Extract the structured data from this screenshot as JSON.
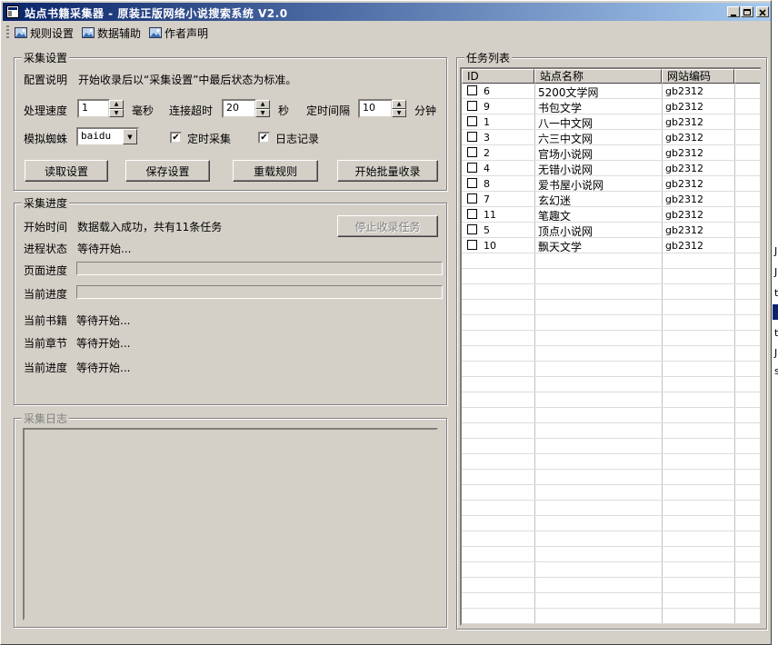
{
  "window": {
    "title": "站点书籍采集器 - 原装正版网络小说搜索系统 V2.0",
    "title_icon": "app-window-icon",
    "controls": [
      "minimize-icon",
      "maximize-icon",
      "close-icon"
    ]
  },
  "menu": [
    {
      "label": "规则设置",
      "icon": "image-icon"
    },
    {
      "label": "数据辅助",
      "icon": "image-icon"
    },
    {
      "label": "作者声明",
      "icon": "image-icon"
    }
  ],
  "settings": {
    "legend": "采集设置",
    "config_label": "配置说明",
    "config_desc": "开始收录后以“采集设置”中最后状态为标准。",
    "speed_label": "处理速度",
    "speed_value": "1",
    "speed_unit": "毫秒",
    "timeout_label": "连接超时",
    "timeout_value": "20",
    "timeout_unit": "秒",
    "interval_label": "定时间隔",
    "interval_value": "10",
    "interval_unit": "分钟",
    "spider_label": "模拟蜘蛛",
    "spider_value": "baidu",
    "timed_label": "定时采集",
    "timed_checked": true,
    "log_label": "日志记录",
    "log_checked": true,
    "btn_read": "读取设置",
    "btn_save": "保存设置",
    "btn_reload": "重载规则",
    "btn_start": "开始批量收录"
  },
  "progress": {
    "legend": "采集进度",
    "start_time_label": "开始时间",
    "start_time_value": "数据载入成功，共有11条任务",
    "stop_button": "停止收录任务",
    "status_label": "进程状态",
    "status_value": "等待开始...",
    "page_progress_label": "页面进度",
    "page_progress_value": 0,
    "current_progress_label": "当前进度",
    "current_progress_value": 0,
    "book_label": "当前书籍",
    "book_value": "等待开始...",
    "chapter_label": "当前章节",
    "chapter_value": "等待开始...",
    "current2_label": "当前进度",
    "current2_value": "等待开始..."
  },
  "log": {
    "legend": "采集日志"
  },
  "tasks": {
    "legend": "任务列表",
    "columns": [
      "ID",
      "站点名称",
      "网站编码"
    ],
    "rows": [
      {
        "id": "6",
        "name": "5200文学网",
        "enc": "gb2312"
      },
      {
        "id": "9",
        "name": "书包文学",
        "enc": "gb2312"
      },
      {
        "id": "1",
        "name": "八一中文网",
        "enc": "gb2312"
      },
      {
        "id": "3",
        "name": "六三中文网",
        "enc": "gb2312"
      },
      {
        "id": "2",
        "name": "官场小说网",
        "enc": "gb2312"
      },
      {
        "id": "4",
        "name": "无错小说网",
        "enc": "gb2312"
      },
      {
        "id": "8",
        "name": "爱书屋小说网",
        "enc": "gb2312"
      },
      {
        "id": "7",
        "name": "玄幻迷",
        "enc": "gb2312"
      },
      {
        "id": "11",
        "name": "笔趣文",
        "enc": "gb2312"
      },
      {
        "id": "5",
        "name": "顶点小说网",
        "enc": "gb2312"
      },
      {
        "id": "10",
        "name": "飘天文学",
        "enc": "gb2312"
      }
    ]
  },
  "background_fragments": [
    "J",
    "J",
    "t",
    "t",
    "J",
    "s"
  ]
}
